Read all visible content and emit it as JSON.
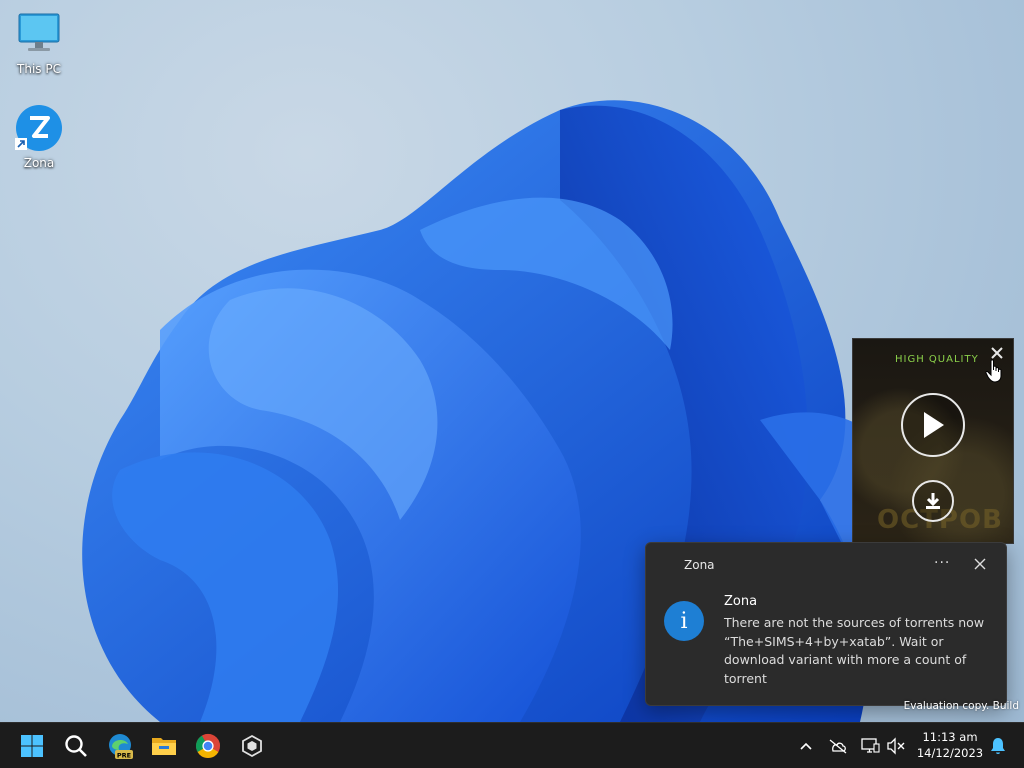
{
  "desktop": {
    "icons": [
      {
        "label": "This PC",
        "icon": "monitor-icon"
      },
      {
        "label": "Zona",
        "icon": "zona-app-icon"
      }
    ]
  },
  "player": {
    "quality_label": "HIGH QUALITY",
    "quality_color": "#8bd14a",
    "poster_text": "OCTPOB"
  },
  "toast": {
    "app_name": "Zona",
    "more_label": "···",
    "title": "Zona",
    "body": "There are not the sources of torrents now “The+SIMS+4+by+xatab”. Wait or download variant with more a count of torrent",
    "icon_color": "#1e7fd4"
  },
  "watermark": {
    "line": "Evaluation copy. Build"
  },
  "taskbar": {
    "apps": [
      "start-icon",
      "search-icon",
      "edge-beta-icon",
      "file-explorer-icon",
      "chrome-icon",
      "app-cube-icon"
    ],
    "clock_time": "11:13 am",
    "clock_date": "14/12/2023"
  }
}
